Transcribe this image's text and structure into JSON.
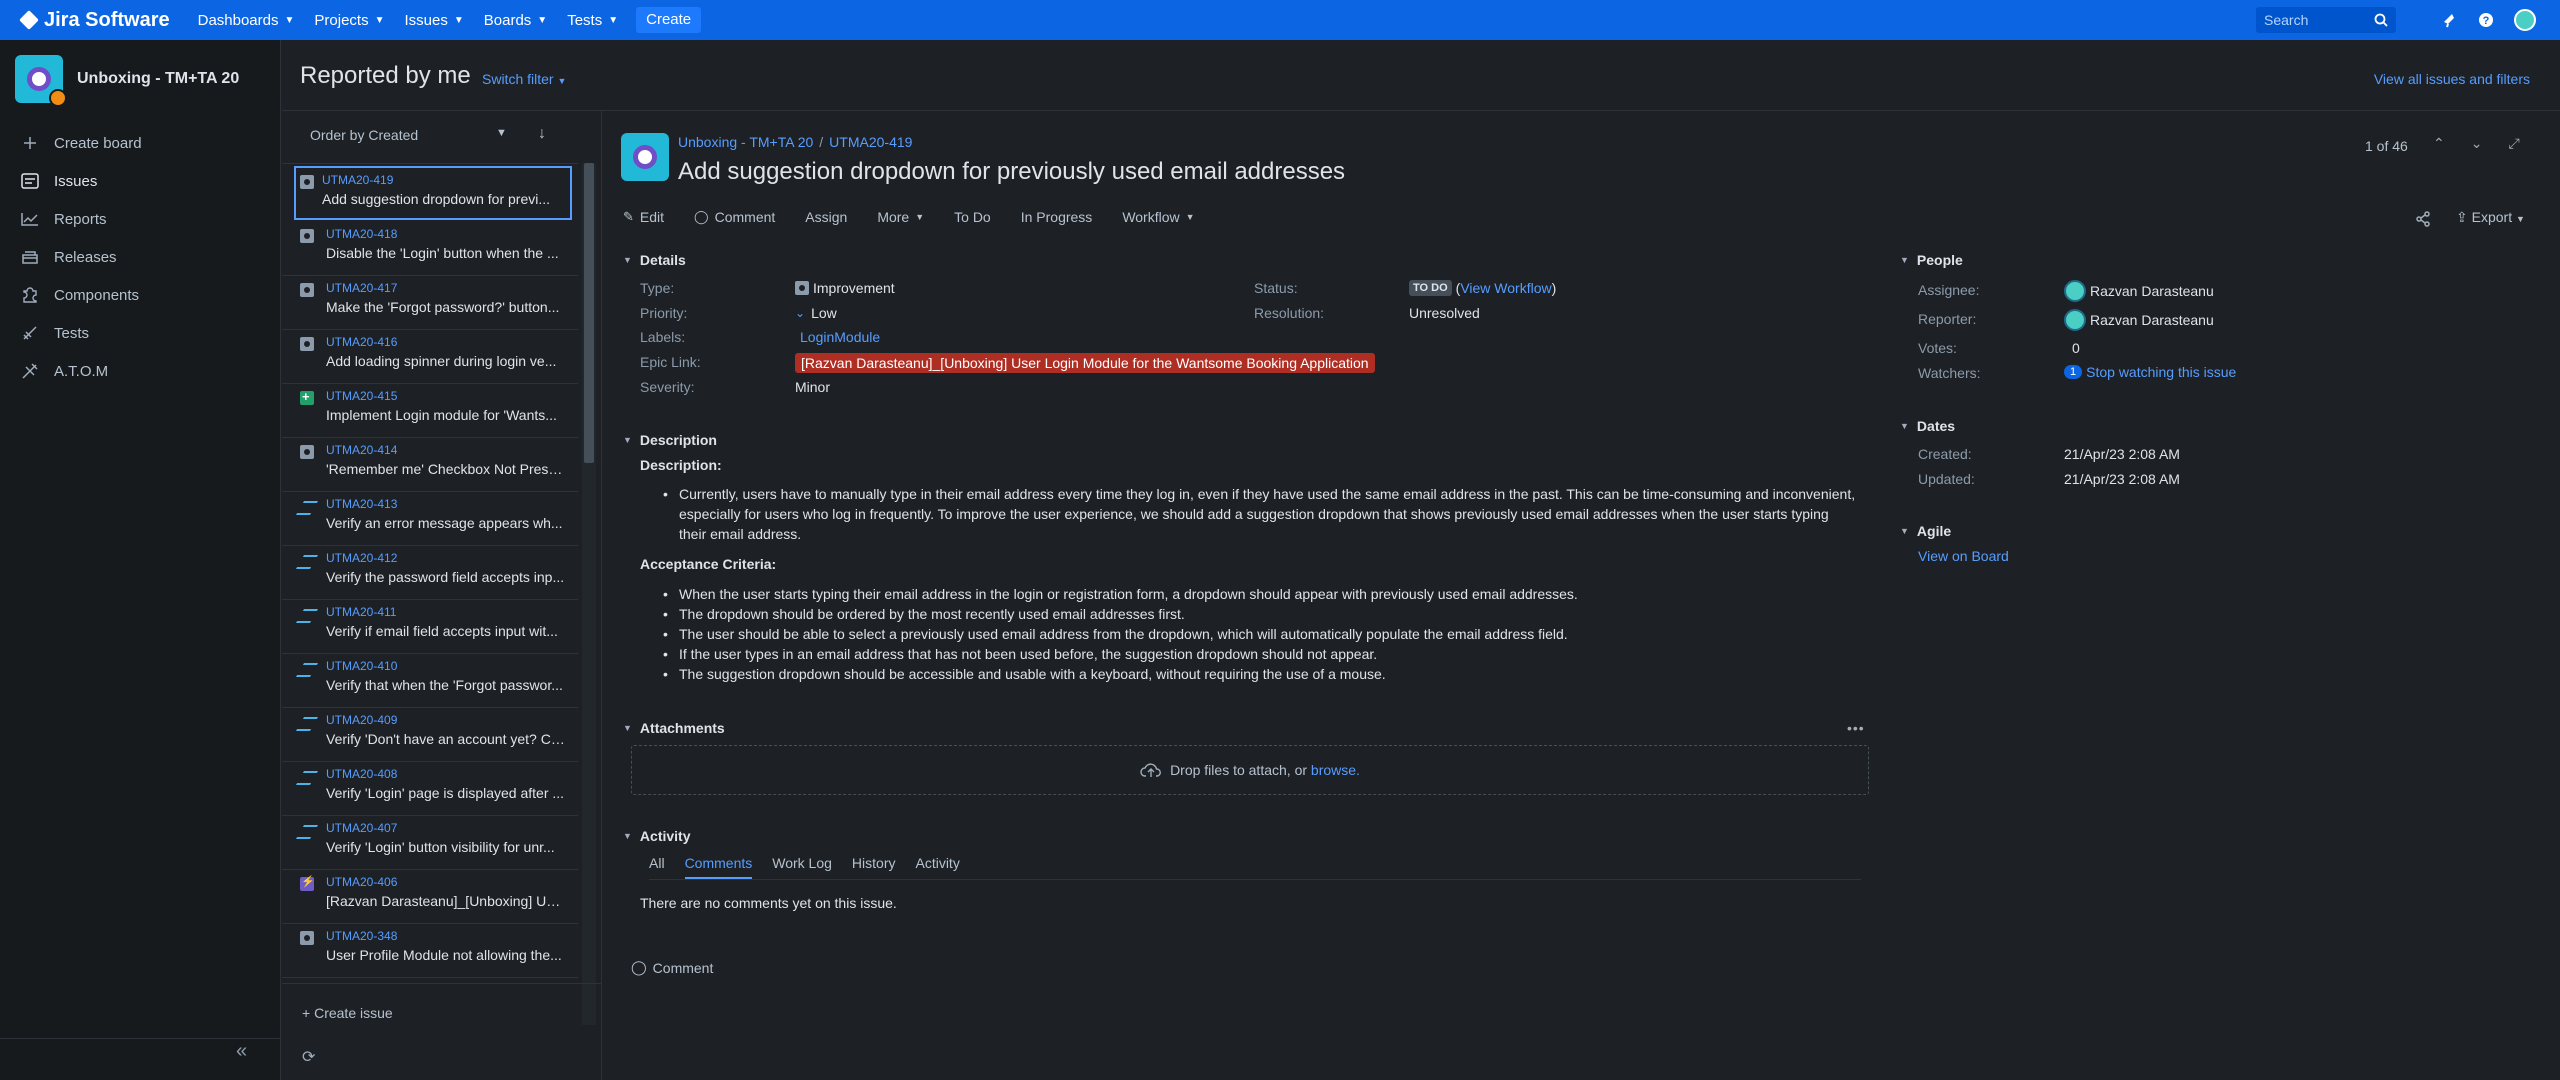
{
  "topnav": {
    "brand": "Jira Software",
    "menus": [
      "Dashboards",
      "Projects",
      "Issues",
      "Boards",
      "Tests"
    ],
    "create_label": "Create",
    "search_placeholder": "Search"
  },
  "sidebar": {
    "project_name": "Unboxing - TM+TA 20",
    "items": [
      {
        "label": "Create board",
        "icon": "plus-icon"
      },
      {
        "label": "Issues",
        "icon": "issues-icon"
      },
      {
        "label": "Reports",
        "icon": "reports-icon"
      },
      {
        "label": "Releases",
        "icon": "releases-icon"
      },
      {
        "label": "Components",
        "icon": "components-icon"
      },
      {
        "label": "Tests",
        "icon": "tests-icon"
      },
      {
        "label": "A.T.O.M",
        "icon": "atom-icon"
      }
    ]
  },
  "filter": {
    "title": "Reported by me",
    "switch_label": "Switch filter",
    "view_all": "View all issues and filters"
  },
  "list": {
    "order_label": "Order by Created",
    "create_issue": "Create issue",
    "rows": [
      {
        "key": "UTMA20-419",
        "summary": "Add suggestion dropdown for previ...",
        "type": "improvement"
      },
      {
        "key": "UTMA20-418",
        "summary": "Disable the 'Login' button when the ...",
        "type": "improvement"
      },
      {
        "key": "UTMA20-417",
        "summary": "Make the 'Forgot password?' button...",
        "type": "improvement"
      },
      {
        "key": "UTMA20-416",
        "summary": "Add loading spinner during login ve...",
        "type": "improvement"
      },
      {
        "key": "UTMA20-415",
        "summary": "Implement Login module for 'Wants...",
        "type": "story"
      },
      {
        "key": "UTMA20-414",
        "summary": "'Remember me' Checkbox Not Prese...",
        "type": "improvement"
      },
      {
        "key": "UTMA20-413",
        "summary": "Verify an error message appears wh...",
        "type": "test"
      },
      {
        "key": "UTMA20-412",
        "summary": "Verify the password field accepts inp...",
        "type": "test"
      },
      {
        "key": "UTMA20-411",
        "summary": "Verify if email field accepts input wit...",
        "type": "test"
      },
      {
        "key": "UTMA20-410",
        "summary": "Verify that when the 'Forgot passwor...",
        "type": "test"
      },
      {
        "key": "UTMA20-409",
        "summary": "Verify 'Don't have an account yet? Cr...",
        "type": "test"
      },
      {
        "key": "UTMA20-408",
        "summary": "Verify 'Login' page is displayed after ...",
        "type": "test"
      },
      {
        "key": "UTMA20-407",
        "summary": "Verify 'Login' button visibility for unr...",
        "type": "test"
      },
      {
        "key": "UTMA20-406",
        "summary": "[Razvan Darasteanu]_[Unboxing] Use...",
        "type": "epic"
      },
      {
        "key": "UTMA20-348",
        "summary": "User Profile Module not allowing the...",
        "type": "improvement"
      }
    ]
  },
  "issue": {
    "project_link": "Unboxing - TM+TA 20",
    "key": "UTMA20-419",
    "title": "Add suggestion dropdown for previously used email addresses",
    "pager": "1 of 46",
    "toolbar": {
      "edit": "Edit",
      "comment": "Comment",
      "assign": "Assign",
      "more": "More",
      "todo": "To Do",
      "in_progress": "In Progress",
      "workflow": "Workflow",
      "export": "Export"
    },
    "details": {
      "heading": "Details",
      "type_label": "Type:",
      "type": "Improvement",
      "priority_label": "Priority:",
      "priority": "Low",
      "labels_label": "Labels:",
      "labels": "LoginModule",
      "epic_label": "Epic Link:",
      "epic": "[Razvan Darasteanu]_[Unboxing] User Login Module for the Wantsome Booking Application",
      "severity_label": "Severity:",
      "severity": "Minor",
      "status_label": "Status:",
      "status": "TO DO",
      "view_workflow": "View Workflow",
      "resolution_label": "Resolution:",
      "resolution": "Unresolved"
    },
    "description": {
      "heading": "Description",
      "sub": "Description:",
      "paragraph": "Currently, users have to manually type in their email address every time they log in, even if they have used the same email address in the past. This can be time-consuming and inconvenient, especially for users who log in frequently. To improve the user experience, we should add a suggestion dropdown that shows previously used email addresses when the user starts typing their email address.",
      "ac_title": "Acceptance Criteria",
      "criteria": [
        "When the user starts typing their email address in the login or registration form, a dropdown should appear with previously used email addresses.",
        "The dropdown should be ordered by the most recently used email addresses first.",
        "The user should be able to select a previously used email address from the dropdown, which will automatically populate the email address field.",
        "If the user types in an email address that has not been used before, the suggestion dropdown should not appear.",
        "The suggestion dropdown should be accessible and usable with a keyboard, without requiring the use of a mouse."
      ]
    },
    "attachments": {
      "heading": "Attachments",
      "drop_text": "Drop files to attach, or",
      "browse": "browse."
    },
    "activity": {
      "heading": "Activity",
      "tabs": [
        "All",
        "Comments",
        "Work Log",
        "History",
        "Activity"
      ],
      "empty": "There are no comments yet on this issue.",
      "comment_button": "Comment"
    },
    "people": {
      "heading": "People",
      "assignee_label": "Assignee:",
      "assignee": "Razvan Darasteanu",
      "reporter_label": "Reporter:",
      "reporter": "Razvan Darasteanu",
      "votes_label": "Votes:",
      "votes": "0",
      "watchers_label": "Watchers:",
      "watchers": "1",
      "stop_watching": "Stop watching this issue"
    },
    "dates": {
      "heading": "Dates",
      "created_label": "Created:",
      "created": "21/Apr/23 2:08 AM",
      "updated_label": "Updated:",
      "updated": "21/Apr/23 2:08 AM"
    },
    "agile": {
      "heading": "Agile",
      "view_board": "View on Board"
    }
  }
}
